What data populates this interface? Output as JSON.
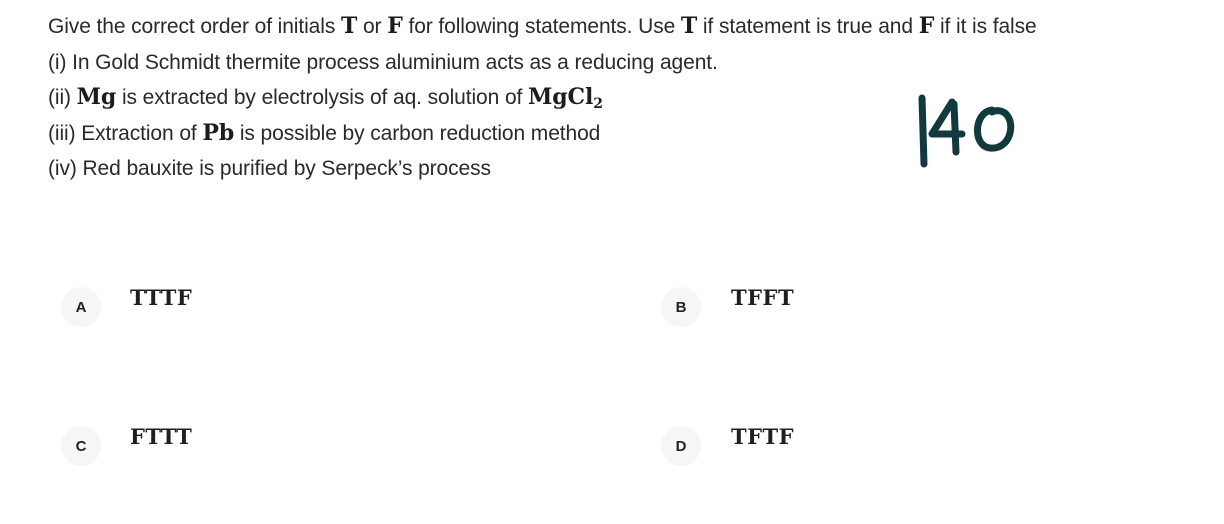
{
  "question": {
    "l1_a": "Give the correct order of initials ",
    "l1_T": "T",
    "l1_b": " or ",
    "l1_F": "F",
    "l1_c": " for following statements. Use ",
    "l1_T2": "T",
    "l1_d": " if statement is true and ",
    "l1_F2": "F",
    "l1_e": " if it is false",
    "s1": "(i) In Gold Schmidt thermite process aluminium acts as a reducing agent.",
    "s2_a": "(ii) ",
    "s2_mg": "Mg",
    "s2_b": " is extracted by electrolysis of aq. solution of ",
    "s2_mgcl": "MgCl",
    "s2_sub": "2",
    "s3_a": "(iii) Extraction of ",
    "s3_pb": "Pb",
    "s3_b": " is possible by carbon reduction method",
    "s4": "(iv) Red bauxite is purified by Serpeck’s process"
  },
  "handwritten_note": "140",
  "options": [
    {
      "letter": "A",
      "text": "TTTF"
    },
    {
      "letter": "B",
      "text": "TFFT"
    },
    {
      "letter": "C",
      "text": "FTTT"
    },
    {
      "letter": "D",
      "text": "TFTF"
    }
  ]
}
